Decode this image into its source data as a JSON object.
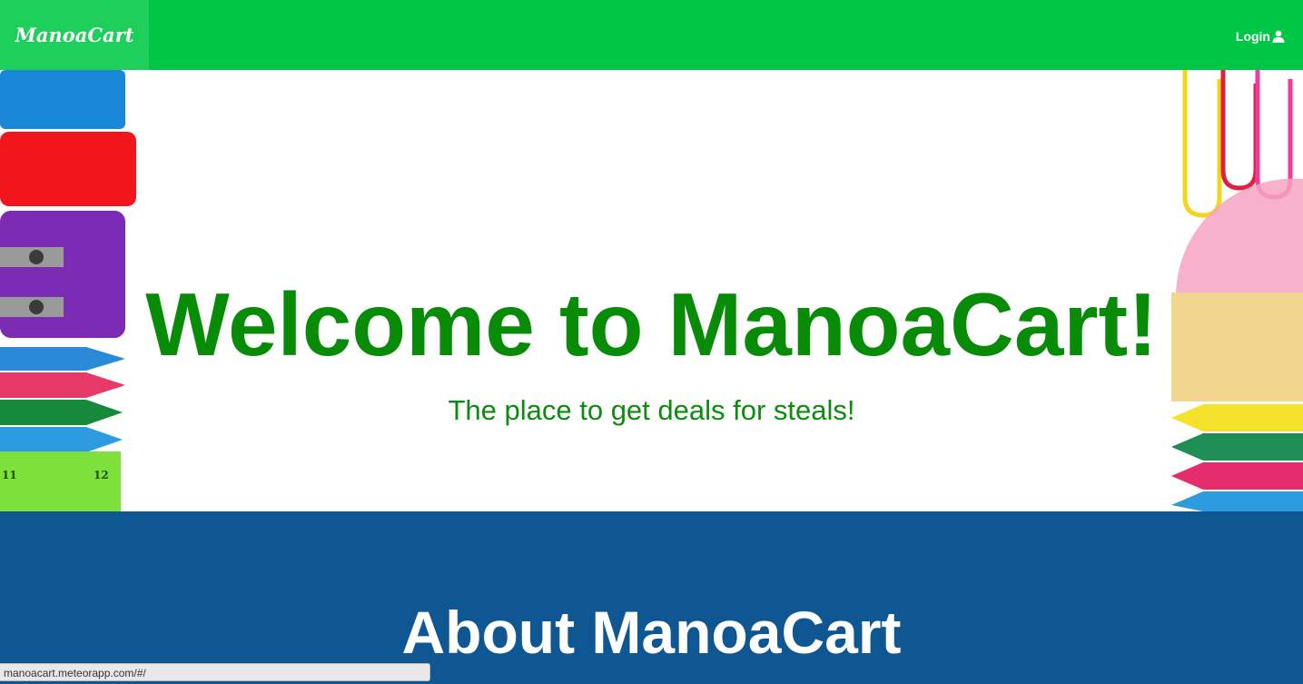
{
  "navbar": {
    "brand": "ManoaCart",
    "login_label": "Login",
    "login_icon": "user-icon",
    "background": "#00c646"
  },
  "hero": {
    "title": "Welcome to ManoaCart!",
    "subtitle": "The place to get deals for steals!",
    "title_color": "#088c08"
  },
  "about": {
    "title": "About ManoaCart",
    "background": "#0e5792"
  },
  "status_bar": {
    "url": "manoacart.meteorapp.com/#/"
  }
}
